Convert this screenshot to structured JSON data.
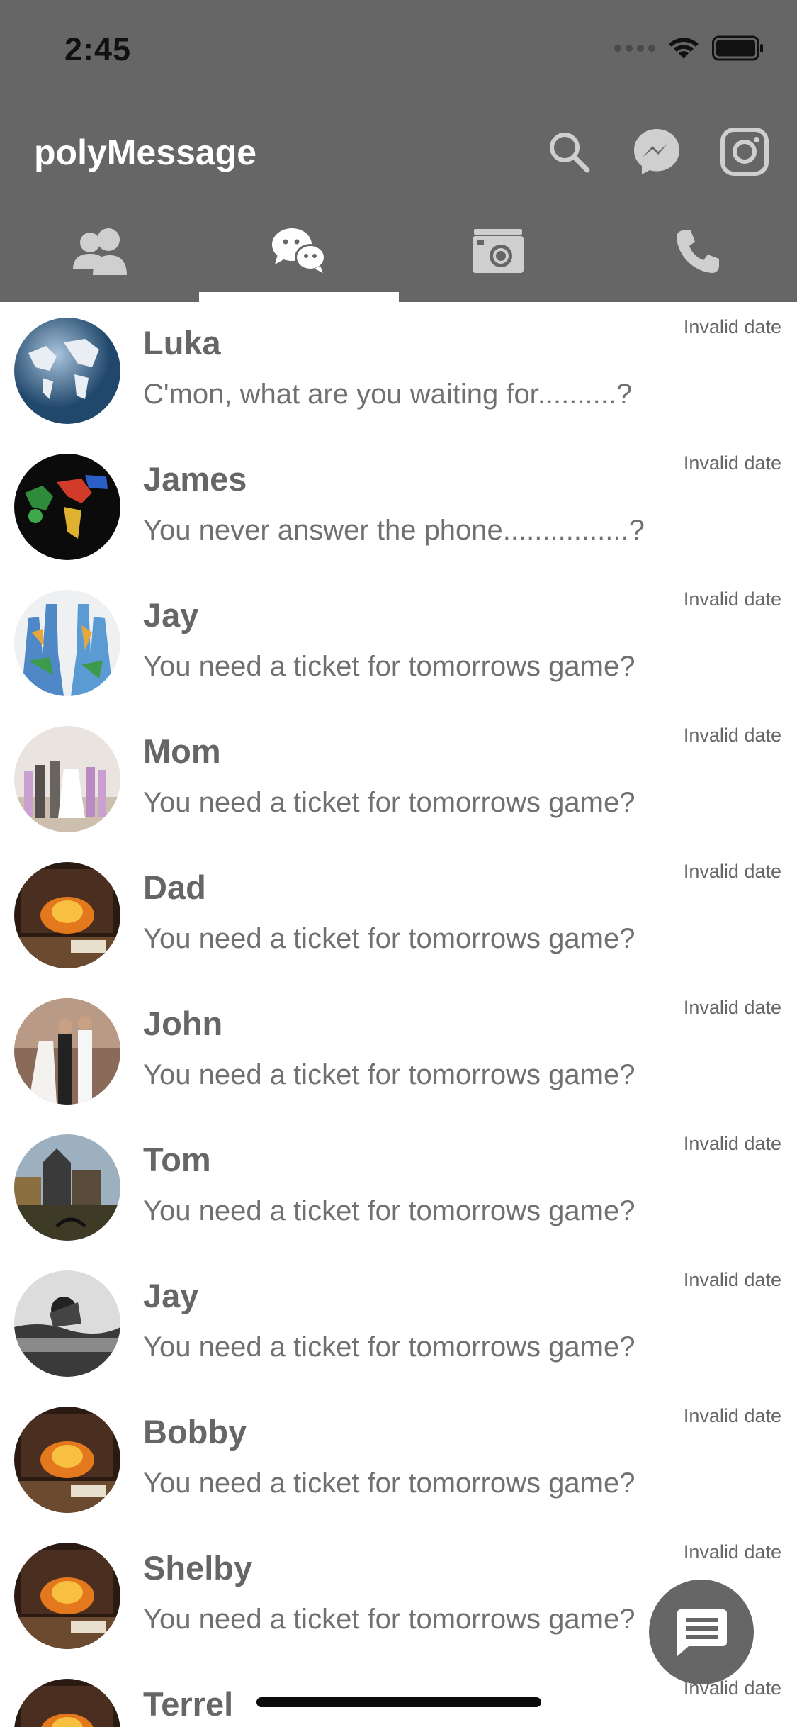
{
  "status_bar": {
    "time": "2:45"
  },
  "header": {
    "title": "polyMessage",
    "actions": [
      {
        "icon": "search-icon"
      },
      {
        "icon": "messenger-icon"
      },
      {
        "icon": "instagram-icon"
      }
    ]
  },
  "tabs": [
    {
      "icon": "contacts-icon",
      "active": false
    },
    {
      "icon": "chat-icon",
      "active": true
    },
    {
      "icon": "camera-icon",
      "active": false
    },
    {
      "icon": "phone-icon",
      "active": false
    }
  ],
  "conversations": [
    {
      "name": "Luka",
      "message": "C'mon, what are you waiting for..........?",
      "date": "Invalid date"
    },
    {
      "name": "James",
      "message": "You never answer the phone................?",
      "date": "Invalid date"
    },
    {
      "name": "Jay",
      "message": "You need a ticket for tomorrows game?",
      "date": "Invalid date"
    },
    {
      "name": "Mom",
      "message": "You need a ticket for tomorrows game?",
      "date": "Invalid date"
    },
    {
      "name": "Dad",
      "message": "You need a ticket for tomorrows game?",
      "date": "Invalid date"
    },
    {
      "name": "John",
      "message": "You need a ticket for tomorrows game?",
      "date": "Invalid date"
    },
    {
      "name": "Tom",
      "message": "You need a ticket for tomorrows game?",
      "date": "Invalid date"
    },
    {
      "name": "Jay",
      "message": "You need a ticket for tomorrows game?",
      "date": "Invalid date"
    },
    {
      "name": "Bobby",
      "message": "You need a ticket for tomorrows game?",
      "date": "Invalid date"
    },
    {
      "name": "Shelby",
      "message": "You need a ticket for tomorrows game?",
      "date": "Invalid date"
    },
    {
      "name": "Terrel",
      "message": "",
      "date": "Invalid date"
    }
  ],
  "colors": {
    "header_bg": "#666666",
    "tab_indicator": "#ffffff",
    "name_text": "#666666",
    "fab_bg": "#666666"
  }
}
